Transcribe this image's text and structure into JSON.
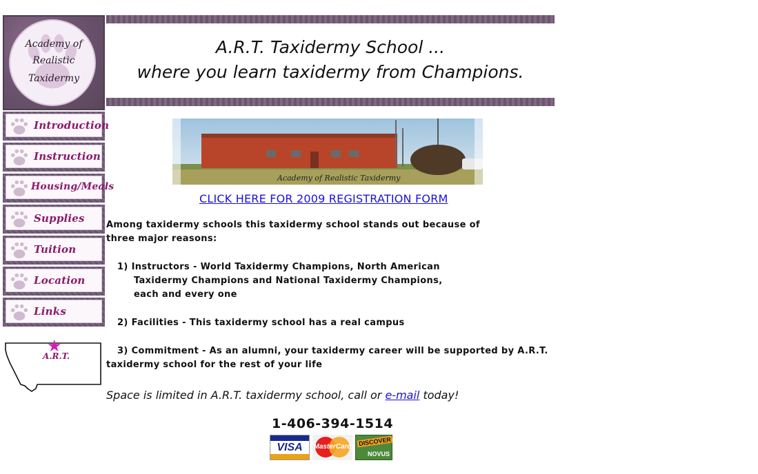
{
  "logo": {
    "line1": "Academy of",
    "line2": "Realistic",
    "line3": "Taxidermy"
  },
  "nav": [
    {
      "label": "Introduction"
    },
    {
      "label": "Instruction"
    },
    {
      "label": "Housing/Meals"
    },
    {
      "label": "Supplies"
    },
    {
      "label": "Tuition"
    },
    {
      "label": "Location"
    },
    {
      "label": "Links"
    }
  ],
  "map": {
    "label": "A.R.T."
  },
  "banner": {
    "line1": "A.R.T. Taxidermy School ...",
    "line2": "where you learn taxidermy from Champions."
  },
  "photo": {
    "caption": "Academy of Realistic Taxidermy"
  },
  "registration_link": "CLICK HERE FOR 2009 REGISTRATION FORM",
  "intro": {
    "line1": "Among taxidermy schools this taxidermy school stands out because of",
    "line2": "three major reasons:"
  },
  "reasons": {
    "r1_line1": "1) Instructors - World Taxidermy Champions, North American",
    "r1_line2": "Taxidermy Champions and National Taxidermy Champions,",
    "r1_line3": "each and every one",
    "r2_line1": "2) Facilities - This taxidermy school has a real campus",
    "r3_line1": "3) Commitment - As an alumni, your taxidermy career will be supported by A.R.T.",
    "r3_line2": "taxidermy school for the rest of your life"
  },
  "cta": {
    "before": "Space is limited in A.R.T. taxidermy school, call or ",
    "link": "e-mail",
    "after": " today!"
  },
  "phone": "1-406-394-1514",
  "cards": {
    "visa": "VISA",
    "mastercard": "MasterCard",
    "discover": "DISCOVER",
    "novus": "NOVUS"
  },
  "colors": {
    "frame_purple": "#6d5470",
    "nav_text": "#8b1a6b",
    "link_blue": "#1a10d8",
    "star": "#d41bb6"
  }
}
